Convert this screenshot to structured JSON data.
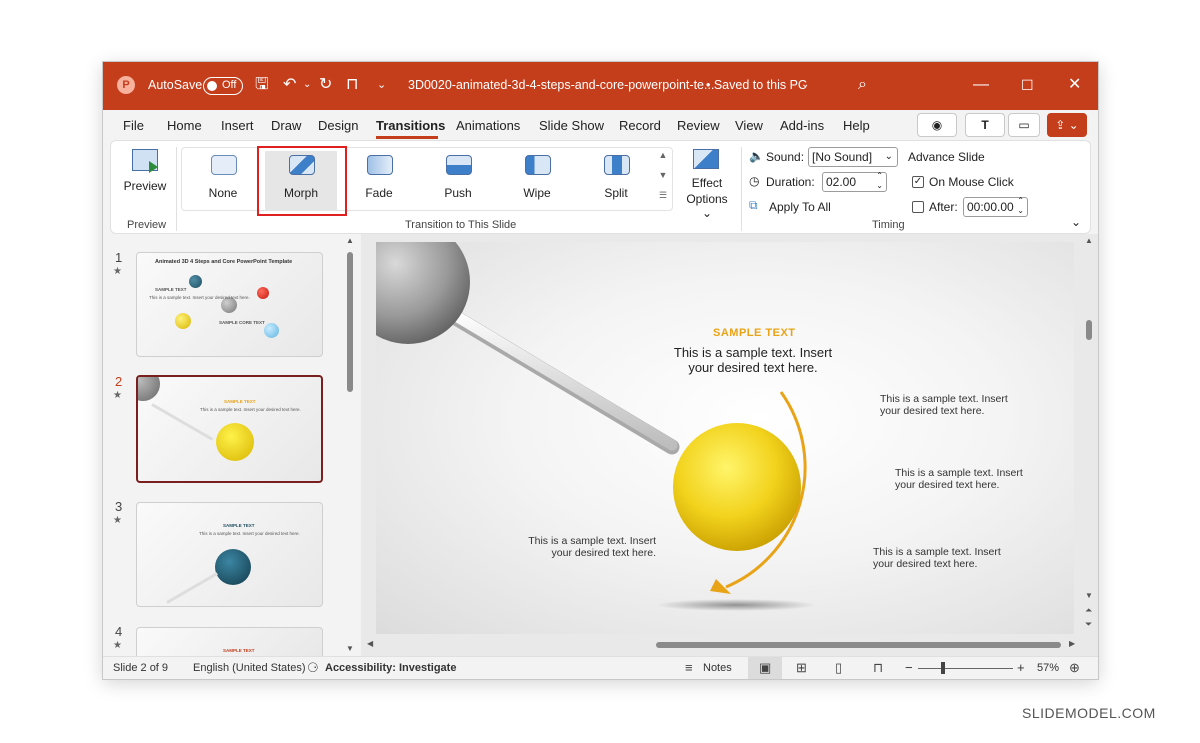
{
  "titlebar": {
    "autosave_label": "AutoSave",
    "autosave_state": "Off",
    "filename": "3D0020-animated-3d-4-steps-and-core-powerpoint-te...",
    "save_status": "• Saved to this PC"
  },
  "menu": {
    "items": [
      "File",
      "Home",
      "Insert",
      "Draw",
      "Design",
      "Transitions",
      "Animations",
      "Slide Show",
      "Record",
      "Review",
      "View",
      "Add-ins",
      "Help"
    ],
    "active": "Transitions"
  },
  "ribbon": {
    "preview": {
      "label": "Preview",
      "group_label": "Preview"
    },
    "transitions": [
      "None",
      "Morph",
      "Fade",
      "Push",
      "Wipe",
      "Split"
    ],
    "selected_transition": "Morph",
    "effect_options": {
      "line1": "Effect",
      "line2": "Options"
    },
    "transition_group_label": "Transition to This Slide",
    "timing": {
      "sound_label": "Sound:",
      "sound_value": "[No Sound]",
      "duration_label": "Duration:",
      "duration_value": "02.00",
      "apply_all_label": "Apply To All",
      "advance_label": "Advance Slide",
      "on_click_label": "On Mouse Click",
      "on_click_checked": true,
      "after_label": "After:",
      "after_value": "00:00.00",
      "after_checked": false,
      "group_label": "Timing"
    }
  },
  "thumbnails": [
    {
      "number": "1",
      "title": "Animated 3D 4 Steps and Core PowerPoint Template",
      "core": "SAMPLE CORE TEXT",
      "sample": "SAMPLE TEXT",
      "body": "This is a sample text. Insert your desired text here."
    },
    {
      "number": "2",
      "sample": "SAMPLE TEXT",
      "body": "This is a sample text. Insert your desired text here."
    },
    {
      "number": "3",
      "sample": "SAMPLE TEXT",
      "body": "This is a sample text. Insert your desired text here."
    },
    {
      "number": "4",
      "sample": "SAMPLE TEXT"
    }
  ],
  "slide": {
    "title": "SAMPLE TEXT",
    "main_line1": "This is a sample text. Insert",
    "main_line2": "your desired text here.",
    "side_line1": "This is a sample text. Insert",
    "side_line2": "your desired text here."
  },
  "statusbar": {
    "slide_info": "Slide 2 of 9",
    "language": "English (United States)",
    "accessibility": "Accessibility: Investigate",
    "notes": "Notes",
    "zoom": "57%"
  },
  "watermark": "SLIDEMODEL.COM",
  "colors": {
    "accent": "#c43e1c",
    "selection": "#e02020",
    "yellow_sphere": "#f2cd1a",
    "arrow": "#e8a317"
  }
}
